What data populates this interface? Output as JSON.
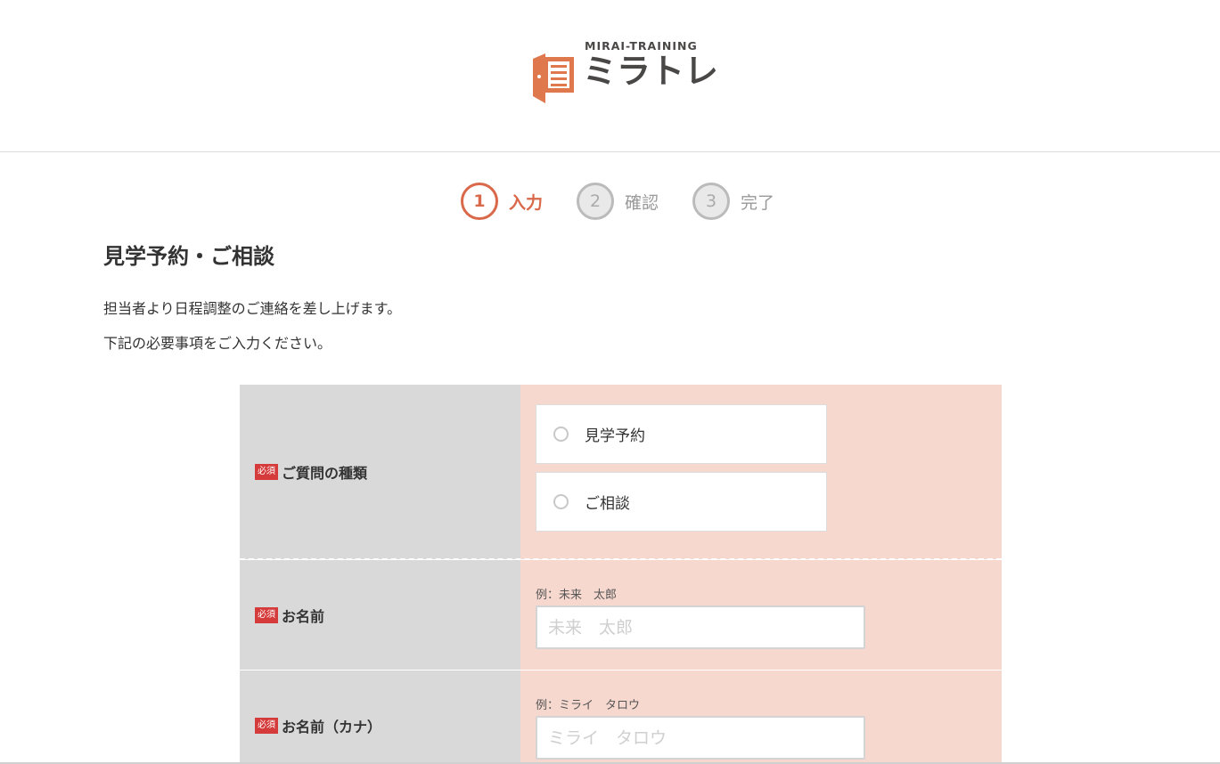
{
  "logo": {
    "sub_text": "MIRAI-TRAINING",
    "main_text": "ミラトレ",
    "brand_color": "#e0784e",
    "text_color": "#4a4747"
  },
  "steps": [
    {
      "number": "1",
      "label": "入力",
      "active": true
    },
    {
      "number": "2",
      "label": "確認",
      "active": false
    },
    {
      "number": "3",
      "label": "完了",
      "active": false
    }
  ],
  "page": {
    "title": "見学予約・ご相談",
    "intro_line1": "担当者より日程調整のご連絡を差し上げます。",
    "intro_line2": "下記の必要事項をご入力ください。"
  },
  "form": {
    "required_badge": "必須",
    "question_type": {
      "label": "ご質問の種類",
      "options": [
        "見学予約",
        "ご相談"
      ]
    },
    "name": {
      "label": "お名前",
      "example": "例：未来　太郎",
      "placeholder": "未来　太郎",
      "value": ""
    },
    "name_kana": {
      "label": "お名前（カナ）",
      "example": "例：ミライ　タロウ",
      "placeholder": "ミライ　タロウ",
      "value": ""
    }
  },
  "colors": {
    "accent": "#d9694a",
    "label_bg": "#d9d9d9",
    "input_bg": "#f6d8cf",
    "required_badge": "#d63b3b"
  }
}
